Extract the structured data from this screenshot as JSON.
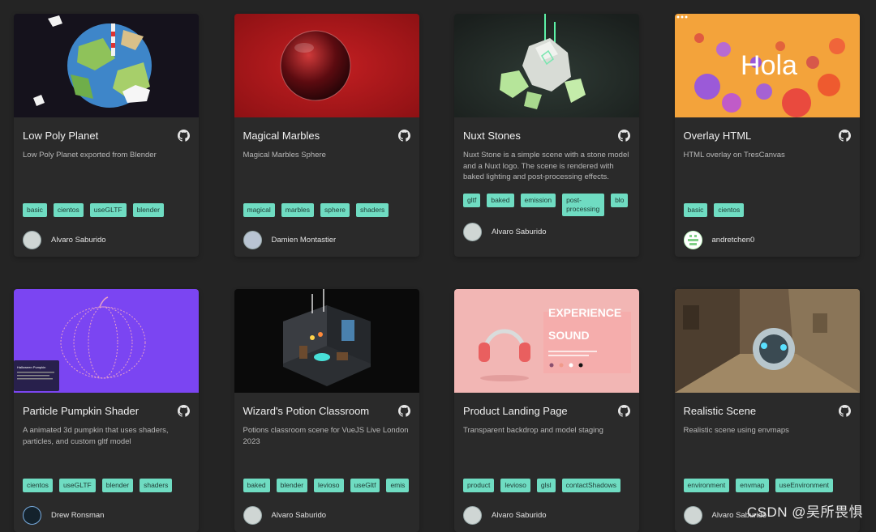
{
  "cards": [
    {
      "title": "Low Poly Planet",
      "description": "Low Poly Planet exported from Blender",
      "tags": [
        "basic",
        "cientos",
        "useGLTF",
        "blender"
      ],
      "author": "Alvaro Saburido"
    },
    {
      "title": "Magical Marbles",
      "description": "Magical Marbles Sphere",
      "tags": [
        "magical",
        "marbles",
        "sphere",
        "shaders"
      ],
      "author": "Damien Montastier"
    },
    {
      "title": "Nuxt Stones",
      "description": "Nuxt Stone is a simple scene with a stone model and a Nuxt logo. The scene is rendered with baked lighting and post-processing effects.",
      "tags": [
        "gltf",
        "baked",
        "emission",
        "post-processing",
        "blo"
      ],
      "author": "Alvaro Saburido"
    },
    {
      "title": "Overlay HTML",
      "description": "HTML overlay on TresCanvas",
      "tags": [
        "basic",
        "cientos"
      ],
      "author": "andretchen0",
      "thumb_text": "Hola"
    },
    {
      "title": "Particle Pumpkin Shader",
      "description": "A animated 3d pumpkin that uses shaders, particles, and custom gltf model",
      "tags": [
        "cientos",
        "useGLTF",
        "blender",
        "shaders"
      ],
      "author": "Drew Ronsman",
      "thumb_text": "Halloween Pumpkin"
    },
    {
      "title": "Wizard's Potion Classroom",
      "description": "Potions classroom scene for VueJS Live London 2023",
      "tags": [
        "baked",
        "blender",
        "levioso",
        "useGltf",
        "emis"
      ],
      "author": "Alvaro Saburido"
    },
    {
      "title": "Product Landing Page",
      "description": "Transparent backdrop and model staging",
      "tags": [
        "product",
        "levioso",
        "glsl",
        "contactShadows"
      ],
      "author": "Alvaro Saburido",
      "thumb_text_1": "EXPERIENCE",
      "thumb_text_2": "SOUND"
    },
    {
      "title": "Realistic Scene",
      "description": "Realistic scene using envmaps",
      "tags": [
        "environment",
        "envmap",
        "useEnvironment"
      ],
      "author": "Alvaro Saburido"
    }
  ],
  "watermark": "CSDN @吴所畏惧",
  "colors": {
    "background": "#242424",
    "card": "#2a2a2a",
    "tag": "#6fdcc2",
    "tag_text": "#1f3b34"
  }
}
